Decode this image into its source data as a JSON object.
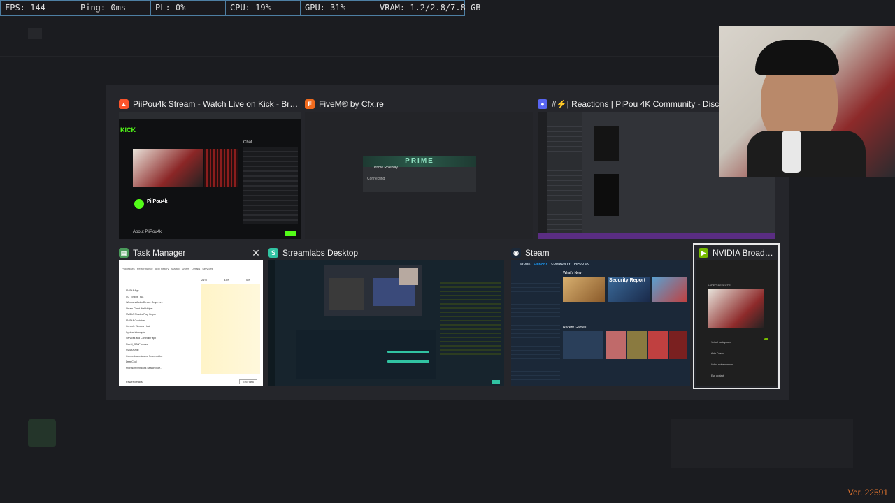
{
  "stats": [
    {
      "text": "FPS: 144"
    },
    {
      "text": "Ping: 0ms"
    },
    {
      "text": "PL: 0%"
    },
    {
      "text": "CPU: 19%"
    },
    {
      "text": "GPU: 31%"
    },
    {
      "text": "VRAM: 1.2/2.8/7.8 GB"
    }
  ],
  "windows": [
    {
      "title": "PiiPou4k Stream - Watch Live on Kick - Brave",
      "icon": "brave-icon",
      "color": "#fb542b"
    },
    {
      "title": "FiveM® by Cfx.re",
      "icon": "fivem-icon",
      "color": "#f06a1d"
    },
    {
      "title": "#⚡| Reactions | PiPou 4K Community - Discord",
      "icon": "discord-icon",
      "color": "#5865f2"
    },
    {
      "title": "Task Manager",
      "icon": "task-manager-icon",
      "color": "#4a9a5a"
    },
    {
      "title": "Streamlabs Desktop",
      "icon": "streamlabs-icon",
      "color": "#31c3a2"
    },
    {
      "title": "Steam",
      "icon": "steam-icon",
      "color": "#1b2838"
    },
    {
      "title": "NVIDIA Broadcast",
      "icon": "nvidia-icon",
      "color": "#76b900"
    }
  ],
  "kick": {
    "logo": "KICK",
    "streamer": "PiiPou4k",
    "chat_label": "Chat",
    "about": "About PiiPou4k"
  },
  "fivem": {
    "server": "Prime Roleplay",
    "banner": "PRIME",
    "status": "Connecting"
  },
  "task_manager": {
    "tabs": [
      "Processes",
      "Performance",
      "App history",
      "Startup",
      "Users",
      "Details",
      "Services"
    ],
    "col_cpu": "21%",
    "col_mem": "33%",
    "col_disk": "0%",
    "col_net": "3%",
    "rows": [
      "NVIDIA App",
      "CC_Engine_x64",
      "Windows Audio Device Graph Is...",
      "Steam Client WebHelper",
      "NVIDIA ShadowPlay Helper",
      "NVIDIA Container",
      "Console Window Host",
      "System interrupts",
      "Services and Controller app",
      "FiveM_GTAProcess",
      "NVIDIA App",
      "Cxhmednaco kasme Scanyuatiba",
      "DeepCool",
      "Microsoft Windows Search Inde..."
    ],
    "fewer_details": "Fewer details",
    "end_task": "End task"
  },
  "steam": {
    "nav": [
      "STORE",
      "LIBRARY",
      "COMMUNITY",
      "PIPOU 4K"
    ],
    "whats_new": "What's New",
    "recent_games": "Recent Games",
    "featured": "Security Report"
  },
  "nvidia": {
    "section": "VIDEO EFFECTS",
    "effects": [
      "Virtual background",
      "Auto Frame",
      "Video noise removal",
      "Eye contact"
    ]
  },
  "version": "Ver. 22591"
}
